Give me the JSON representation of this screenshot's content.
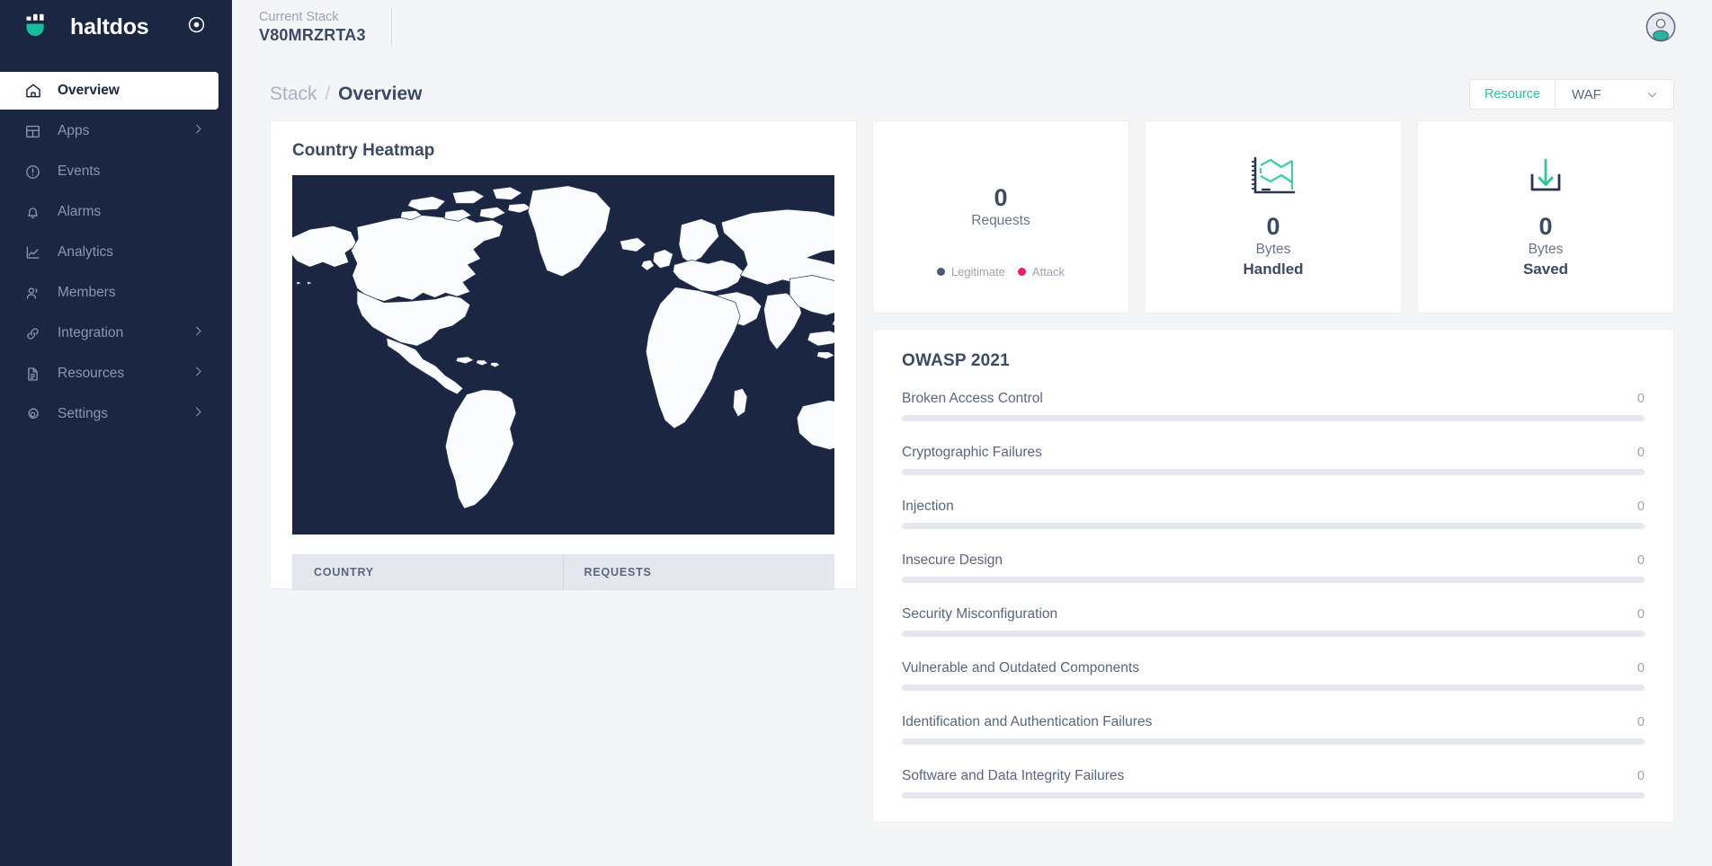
{
  "brand": {
    "name": "haltdos",
    "logo_icon": "haltdos-bowl-logo",
    "target_icon": "target-icon"
  },
  "sidebar": {
    "items": [
      {
        "label": "Overview",
        "icon": "home-icon",
        "active": true,
        "chevron": false
      },
      {
        "label": "Apps",
        "icon": "layout-grid-icon",
        "active": false,
        "chevron": true
      },
      {
        "label": "Events",
        "icon": "alert-circle-icon",
        "active": false,
        "chevron": false
      },
      {
        "label": "Alarms",
        "icon": "bell-icon",
        "active": false,
        "chevron": false
      },
      {
        "label": "Analytics",
        "icon": "chart-line-icon",
        "active": false,
        "chevron": false
      },
      {
        "label": "Members",
        "icon": "users-icon",
        "active": false,
        "chevron": false
      },
      {
        "label": "Integration",
        "icon": "link-icon",
        "active": false,
        "chevron": true
      },
      {
        "label": "Resources",
        "icon": "document-icon",
        "active": false,
        "chevron": true
      },
      {
        "label": "Settings",
        "icon": "gear-icon",
        "active": false,
        "chevron": true
      }
    ]
  },
  "topbar": {
    "stack_label": "Current Stack",
    "stack_value": "V80MRZRTA3",
    "avatar_icon": "user-avatar-icon"
  },
  "breadcrumb": {
    "parent": "Stack",
    "separator": "/",
    "current": "Overview"
  },
  "resource_select": {
    "tag": "Resource",
    "value": "WAF",
    "chevron_icon": "chevron-down-icon",
    "options": [
      "WAF"
    ]
  },
  "heatmap": {
    "title": "Country Heatmap",
    "table": {
      "columns": [
        "COUNTRY",
        "REQUESTS"
      ],
      "rows": []
    },
    "ocean_color": "#1b2642",
    "land_color": "#fbfcfd"
  },
  "stats": [
    {
      "value": "0",
      "caption": "Requests",
      "icon": null,
      "legend": [
        {
          "label": "Legitimate",
          "color": "#4b5a78"
        },
        {
          "label": "Attack",
          "color": "#e91e63"
        }
      ]
    },
    {
      "value": "0",
      "caption_top": "Bytes",
      "caption_bottom": "Handled",
      "icon": "area-chart-icon"
    },
    {
      "value": "0",
      "caption_top": "Bytes",
      "caption_bottom": "Saved",
      "icon": "download-tray-icon"
    }
  ],
  "owasp": {
    "title": "OWASP 2021",
    "accent": "#2fc49a",
    "track": "#e4e8ee",
    "rows": [
      {
        "name": "Broken Access Control",
        "value": "0",
        "pct": 0
      },
      {
        "name": "Cryptographic Failures",
        "value": "0",
        "pct": 0
      },
      {
        "name": "Injection",
        "value": "0",
        "pct": 0
      },
      {
        "name": "Insecure Design",
        "value": "0",
        "pct": 0
      },
      {
        "name": "Security Misconfiguration",
        "value": "0",
        "pct": 0
      },
      {
        "name": "Vulnerable and Outdated Components",
        "value": "0",
        "pct": 0
      },
      {
        "name": "Identification and Authentication Failures",
        "value": "0",
        "pct": 0
      },
      {
        "name": "Software and Data Integrity Failures",
        "value": "0",
        "pct": 0
      }
    ]
  },
  "colors": {
    "sidebar_bg": "#1b2642",
    "accent_teal": "#2fc49a",
    "text_dark": "#3d4a63",
    "page_bg": "#f4f5f7"
  }
}
